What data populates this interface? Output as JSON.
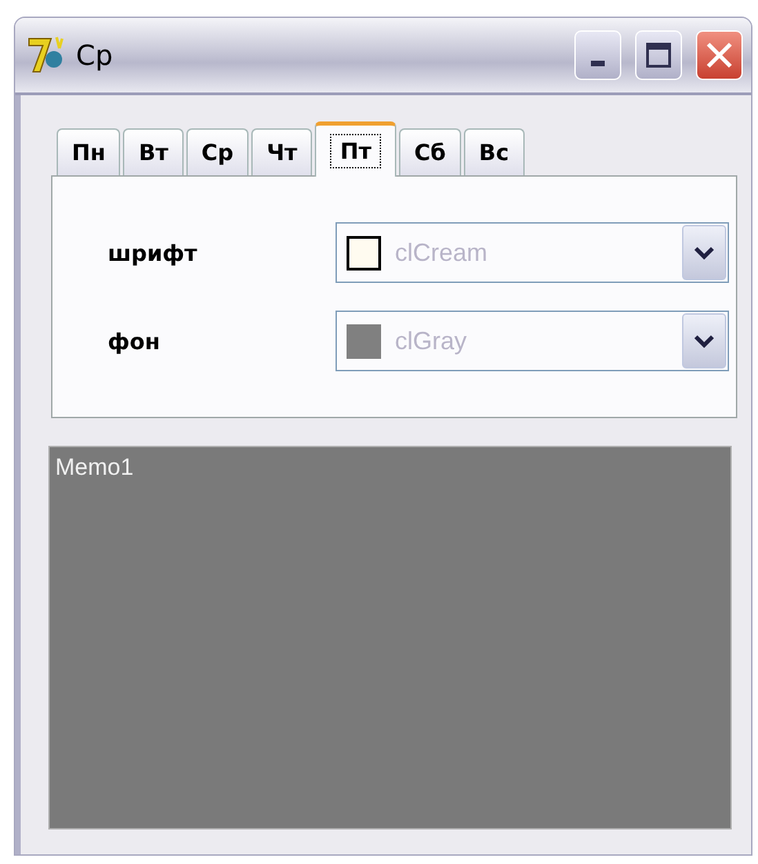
{
  "window": {
    "title": "Ср"
  },
  "tabs": [
    {
      "label": "Пн",
      "selected": false
    },
    {
      "label": "Вт",
      "selected": false
    },
    {
      "label": "Ср",
      "selected": false
    },
    {
      "label": "Чт",
      "selected": false
    },
    {
      "label": "Пт",
      "selected": true
    },
    {
      "label": "Сб",
      "selected": false
    },
    {
      "label": "Вс",
      "selected": false
    }
  ],
  "fields": [
    {
      "label": "шрифт",
      "value": "clCream",
      "color": "#fffbf0",
      "disabled": true
    },
    {
      "label": "фон",
      "value": "clGray",
      "color": "#808080",
      "disabled": true
    }
  ],
  "memo": {
    "text": "Memo1"
  }
}
